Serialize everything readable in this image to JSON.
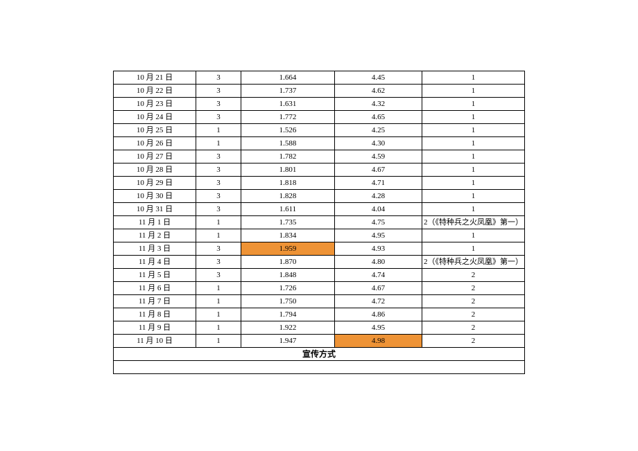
{
  "table": {
    "rows": [
      {
        "date": "10 月 21 日",
        "a": "3",
        "b": "1.664",
        "c": "4.45",
        "d": "1",
        "hl_b": false,
        "hl_c": false
      },
      {
        "date": "10 月 22 日",
        "a": "3",
        "b": "1.737",
        "c": "4.62",
        "d": "1",
        "hl_b": false,
        "hl_c": false
      },
      {
        "date": "10 月 23 日",
        "a": "3",
        "b": "1.631",
        "c": "4.32",
        "d": "1",
        "hl_b": false,
        "hl_c": false
      },
      {
        "date": "10 月 24 日",
        "a": "3",
        "b": "1.772",
        "c": "4.65",
        "d": "1",
        "hl_b": false,
        "hl_c": false
      },
      {
        "date": "10 月 25 日",
        "a": "1",
        "b": "1.526",
        "c": "4.25",
        "d": "1",
        "hl_b": false,
        "hl_c": false
      },
      {
        "date": "10 月 26 日",
        "a": "1",
        "b": "1.588",
        "c": "4.30",
        "d": "1",
        "hl_b": false,
        "hl_c": false
      },
      {
        "date": "10 月 27 日",
        "a": "3",
        "b": "1.782",
        "c": "4.59",
        "d": "1",
        "hl_b": false,
        "hl_c": false
      },
      {
        "date": "10 月 28 日",
        "a": "3",
        "b": "1.801",
        "c": "4.67",
        "d": "1",
        "hl_b": false,
        "hl_c": false
      },
      {
        "date": "10 月 29 日",
        "a": "3",
        "b": "1.818",
        "c": "4.71",
        "d": "1",
        "hl_b": false,
        "hl_c": false
      },
      {
        "date": "10 月 30 日",
        "a": "3",
        "b": "1.828",
        "c": "4.28",
        "d": "1",
        "hl_b": false,
        "hl_c": false
      },
      {
        "date": "10 月 31 日",
        "a": "3",
        "b": "1.611",
        "c": "4.04",
        "d": "1",
        "hl_b": false,
        "hl_c": false
      },
      {
        "date": "11 月 1 日",
        "a": "1",
        "b": "1.735",
        "c": "4.75",
        "d": "2（《特种兵之火凤凰》第一）",
        "hl_b": false,
        "hl_c": false
      },
      {
        "date": "11 月 2 日",
        "a": "1",
        "b": "1.834",
        "c": "4.95",
        "d": "1",
        "hl_b": false,
        "hl_c": false
      },
      {
        "date": "11 月 3 日",
        "a": "3",
        "b": "1.959",
        "c": "4.93",
        "d": "1",
        "hl_b": true,
        "hl_c": false
      },
      {
        "date": "11 月 4 日",
        "a": "3",
        "b": "1.870",
        "c": "4.80",
        "d": "2（《特种兵之火凤凰》第一）",
        "hl_b": false,
        "hl_c": false
      },
      {
        "date": "11 月 5 日",
        "a": "3",
        "b": "1.848",
        "c": "4.74",
        "d": "2",
        "hl_b": false,
        "hl_c": false
      },
      {
        "date": "11 月 6 日",
        "a": "1",
        "b": "1.726",
        "c": "4.67",
        "d": "2",
        "hl_b": false,
        "hl_c": false
      },
      {
        "date": "11 月 7 日",
        "a": "1",
        "b": "1.750",
        "c": "4.72",
        "d": "2",
        "hl_b": false,
        "hl_c": false
      },
      {
        "date": "11 月 8 日",
        "a": "1",
        "b": "1.794",
        "c": "4.86",
        "d": "2",
        "hl_b": false,
        "hl_c": false
      },
      {
        "date": "11 月 9 日",
        "a": "1",
        "b": "1.922",
        "c": "4.95",
        "d": "2",
        "hl_b": false,
        "hl_c": false
      },
      {
        "date": "11 月 10 日",
        "a": "1",
        "b": "1.947",
        "c": "4.98",
        "d": "2",
        "hl_b": false,
        "hl_c": true
      }
    ],
    "footer": "宣传方式"
  },
  "colors": {
    "highlight": "#ee9336"
  }
}
